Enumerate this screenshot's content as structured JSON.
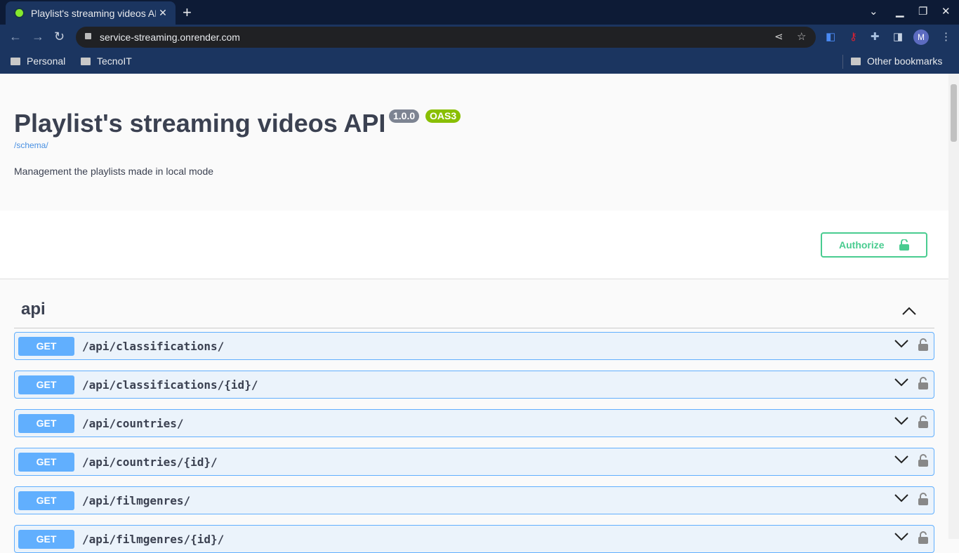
{
  "browser": {
    "tab_title": "Playlist's streaming videos API",
    "url": "service-streaming.onrender.com",
    "avatar_letter": "M",
    "bookmarks": [
      "Personal",
      "TecnoIT"
    ],
    "other_bookmarks": "Other bookmarks"
  },
  "header": {
    "title": "Playlist's streaming videos API",
    "version": "1.0.0",
    "oas": "OAS3",
    "schema_link": "/schema/",
    "description": "Management the playlists made in local mode"
  },
  "authorize_label": "Authorize",
  "tag": {
    "name": "api"
  },
  "operations": [
    {
      "method": "GET",
      "path": "/api/classifications/"
    },
    {
      "method": "GET",
      "path": "/api/classifications/{id}/"
    },
    {
      "method": "GET",
      "path": "/api/countries/"
    },
    {
      "method": "GET",
      "path": "/api/countries/{id}/"
    },
    {
      "method": "GET",
      "path": "/api/filmgenres/"
    },
    {
      "method": "GET",
      "path": "/api/filmgenres/{id}/"
    }
  ],
  "colors": {
    "get": "#61affe",
    "authorize": "#49cc90",
    "oas": "#89bf04",
    "version": "#7d8492"
  }
}
